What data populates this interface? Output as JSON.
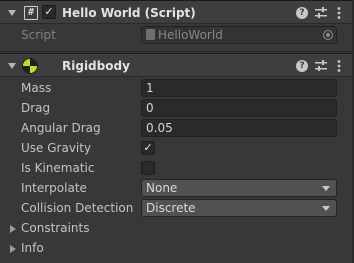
{
  "script_component": {
    "title": "Hello World (Script)",
    "enabled_check": "✓",
    "script_label": "Script",
    "script_value": "HelloWorld"
  },
  "rigidbody": {
    "title": "Rigidbody",
    "properties": {
      "mass": {
        "label": "Mass",
        "value": "1"
      },
      "drag": {
        "label": "Drag",
        "value": "0"
      },
      "angular_drag": {
        "label": "Angular Drag",
        "value": "0.05"
      },
      "use_gravity": {
        "label": "Use Gravity",
        "check": "✓"
      },
      "is_kinematic": {
        "label": "Is Kinematic",
        "check": ""
      },
      "interpolate": {
        "label": "Interpolate",
        "value": "None"
      },
      "collision_detection": {
        "label": "Collision Detection",
        "value": "Discrete"
      }
    },
    "foldouts": {
      "constraints": "Constraints",
      "info": "Info"
    }
  },
  "icons": {
    "help": "?",
    "script_hash": "#"
  },
  "colors": {
    "background": "#383838",
    "header": "#3e3e3e",
    "field": "#2a2a2a",
    "dropdown": "#515151",
    "rigidbody_icon": "#3f7d1e"
  }
}
